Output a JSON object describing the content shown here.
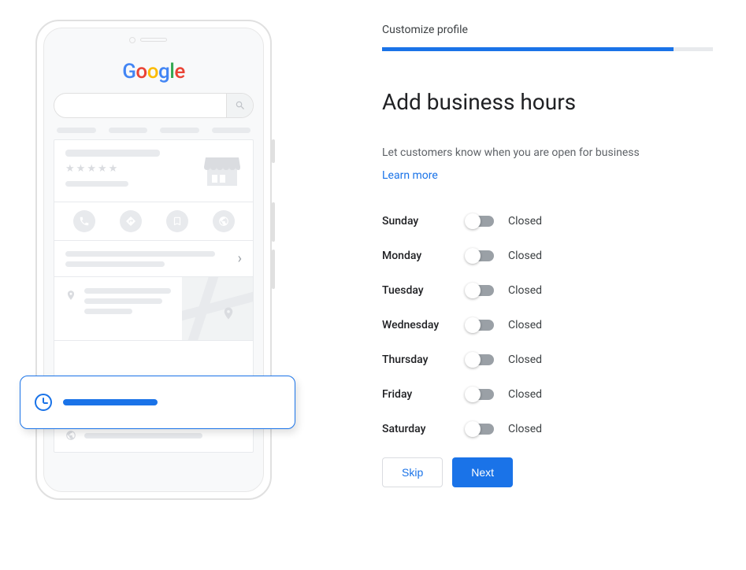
{
  "step": {
    "label": "Customize profile",
    "progress": 88
  },
  "heading": "Add business hours",
  "description": "Let customers know when you are open for business",
  "learn_more": "Learn more",
  "days": [
    {
      "name": "Sunday",
      "status": "Closed",
      "enabled": false
    },
    {
      "name": "Monday",
      "status": "Closed",
      "enabled": false
    },
    {
      "name": "Tuesday",
      "status": "Closed",
      "enabled": false
    },
    {
      "name": "Wednesday",
      "status": "Closed",
      "enabled": false
    },
    {
      "name": "Thursday",
      "status": "Closed",
      "enabled": false
    },
    {
      "name": "Friday",
      "status": "Closed",
      "enabled": false
    },
    {
      "name": "Saturday",
      "status": "Closed",
      "enabled": false
    }
  ],
  "buttons": {
    "skip": "Skip",
    "next": "Next"
  },
  "illustration": {
    "logo": "Google"
  }
}
